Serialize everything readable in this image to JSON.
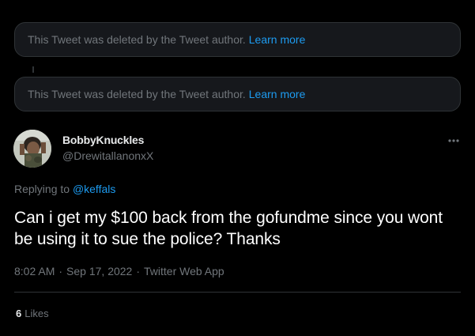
{
  "deleted_notices": [
    {
      "text": "This Tweet was deleted by the Tweet author.",
      "link": "Learn more"
    },
    {
      "text": "This Tweet was deleted by the Tweet author.",
      "link": "Learn more"
    }
  ],
  "tweet": {
    "author_name": "BobbyKnuckles",
    "author_handle": "@DrewitallanonxX",
    "replying_to_prefix": "Replying to",
    "replying_to_handle": "@keffals",
    "text": "Can i get my $100 back from the gofundme since you wont be using it to sue the police?  Thanks",
    "time": "8:02 AM",
    "separator": "·",
    "date": "Sep 17, 2022",
    "client": "Twitter Web App",
    "likes_count": "6",
    "likes_label": "Likes"
  },
  "icons": {
    "more": "more-horizontal-icon"
  },
  "colors": {
    "background": "#000000",
    "card": "#16181c",
    "border": "#2f3336",
    "text_primary": "#e7e9ea",
    "text_secondary": "#71767b",
    "link": "#1d9bf0"
  }
}
